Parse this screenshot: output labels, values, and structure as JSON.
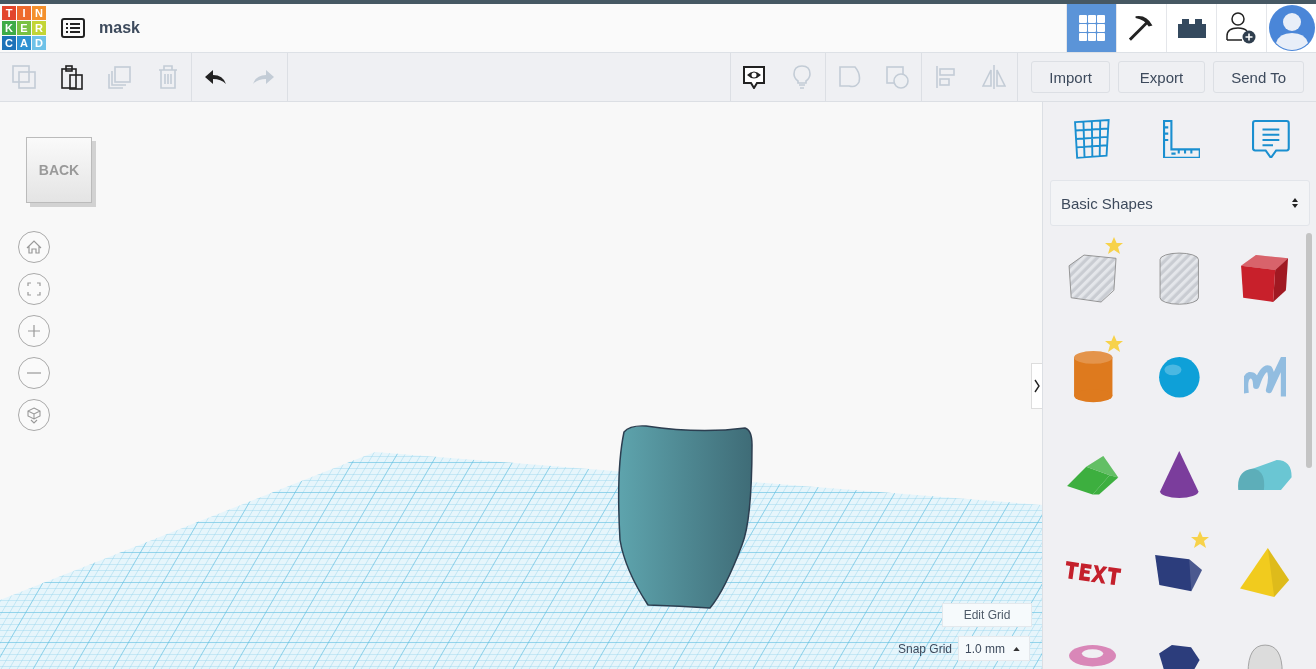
{
  "logo": {
    "cells": [
      {
        "letter": "T",
        "color": "#e2452c"
      },
      {
        "letter": "I",
        "color": "#ee6a2c"
      },
      {
        "letter": "N",
        "color": "#f4902c"
      },
      {
        "letter": "K",
        "color": "#3fab47"
      },
      {
        "letter": "E",
        "color": "#79c143"
      },
      {
        "letter": "R",
        "color": "#c3d535"
      },
      {
        "letter": "C",
        "color": "#1c72b8"
      },
      {
        "letter": "A",
        "color": "#2f92d2"
      },
      {
        "letter": "D",
        "color": "#6fc2e8"
      }
    ]
  },
  "title": "mask",
  "header_nav": [
    {
      "kind": "grid",
      "selected": true
    },
    {
      "kind": "pickaxe",
      "selected": false
    },
    {
      "kind": "bricks",
      "selected": false
    },
    {
      "kind": "add-user",
      "selected": false
    },
    {
      "kind": "avatar",
      "selected": false
    }
  ],
  "toolbar": {
    "left": [
      {
        "kind": "copy",
        "disabled": true
      },
      {
        "kind": "paste",
        "disabled": false
      },
      {
        "kind": "duplicate",
        "disabled": true
      },
      {
        "kind": "delete",
        "disabled": true
      },
      {
        "kind": "undo",
        "disabled": false
      },
      {
        "kind": "redo",
        "disabled": true
      }
    ],
    "right": [
      {
        "kind": "show-all",
        "disabled": false
      },
      {
        "kind": "bulb",
        "disabled": true
      },
      {
        "kind": "solid",
        "disabled": true
      },
      {
        "kind": "hole",
        "disabled": true
      },
      {
        "kind": "align",
        "disabled": true
      },
      {
        "kind": "mirror",
        "disabled": true
      }
    ],
    "actions": [
      "Import",
      "Export",
      "Send To"
    ]
  },
  "view_cube": {
    "label": "BACK"
  },
  "view_controls": [
    {
      "kind": "home"
    },
    {
      "kind": "fit"
    },
    {
      "kind": "zoom-in"
    },
    {
      "kind": "zoom-out"
    },
    {
      "kind": "ortho"
    }
  ],
  "grid_controls": {
    "edit_grid": "Edit Grid",
    "snap_label": "Snap Grid",
    "snap_value": "1.0 mm"
  },
  "panel": {
    "tools": [
      {
        "kind": "workplane"
      },
      {
        "kind": "ruler"
      },
      {
        "kind": "notes"
      }
    ],
    "library": "Basic Shapes",
    "shapes": [
      {
        "kind": "box-hole",
        "starred": true
      },
      {
        "kind": "cylinder-hole",
        "starred": false
      },
      {
        "kind": "box",
        "color": "#c8202b",
        "starred": false
      },
      {
        "kind": "cylinder",
        "color": "#de7a1e",
        "starred": true
      },
      {
        "kind": "sphere",
        "color": "#0ea0d8",
        "starred": false
      },
      {
        "kind": "scribble",
        "color": "#92bde0",
        "starred": false
      },
      {
        "kind": "roof",
        "color": "#3daf3f",
        "starred": false
      },
      {
        "kind": "cone",
        "color": "#7b3d9c",
        "starred": false
      },
      {
        "kind": "round-roof",
        "color": "#6ac6d3",
        "starred": false
      },
      {
        "kind": "text",
        "color": "#c4202c",
        "starred": false
      },
      {
        "kind": "wedge",
        "color": "#2c3d7c",
        "starred": true
      },
      {
        "kind": "pyramid",
        "color": "#f1cb1e",
        "starred": false
      },
      {
        "kind": "torus",
        "color": "#d987b8",
        "starred": false
      },
      {
        "kind": "hexagon",
        "color": "#2c3d7c",
        "starred": false
      },
      {
        "kind": "half-sphere",
        "color": "#dcdcdc",
        "starred": false
      }
    ]
  }
}
